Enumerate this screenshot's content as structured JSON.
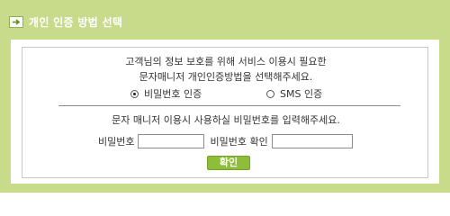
{
  "header": {
    "title": "개인 인증 방법 선택",
    "icon": "arrow-right-icon"
  },
  "intro": {
    "line1": "고객님의 정보 보호를 위해 서비스 이용시 필요한",
    "line2": "문자매니저 개인인증방법을 선택해주세요."
  },
  "auth_options": [
    {
      "label": "비밀번호 인증",
      "selected": true
    },
    {
      "label": "SMS 인증",
      "selected": false
    }
  ],
  "password_section": {
    "prompt": "문자 매니저 이용시 사용하실 비밀번호를 입력해주세요.",
    "password_label": "비밀번호",
    "password_value": "",
    "confirm_label": "비밀번호 확인",
    "confirm_value": ""
  },
  "confirm_button": {
    "label": "확인"
  },
  "colors": {
    "frame": "#c7db8a",
    "button": "#8ebd3a"
  }
}
